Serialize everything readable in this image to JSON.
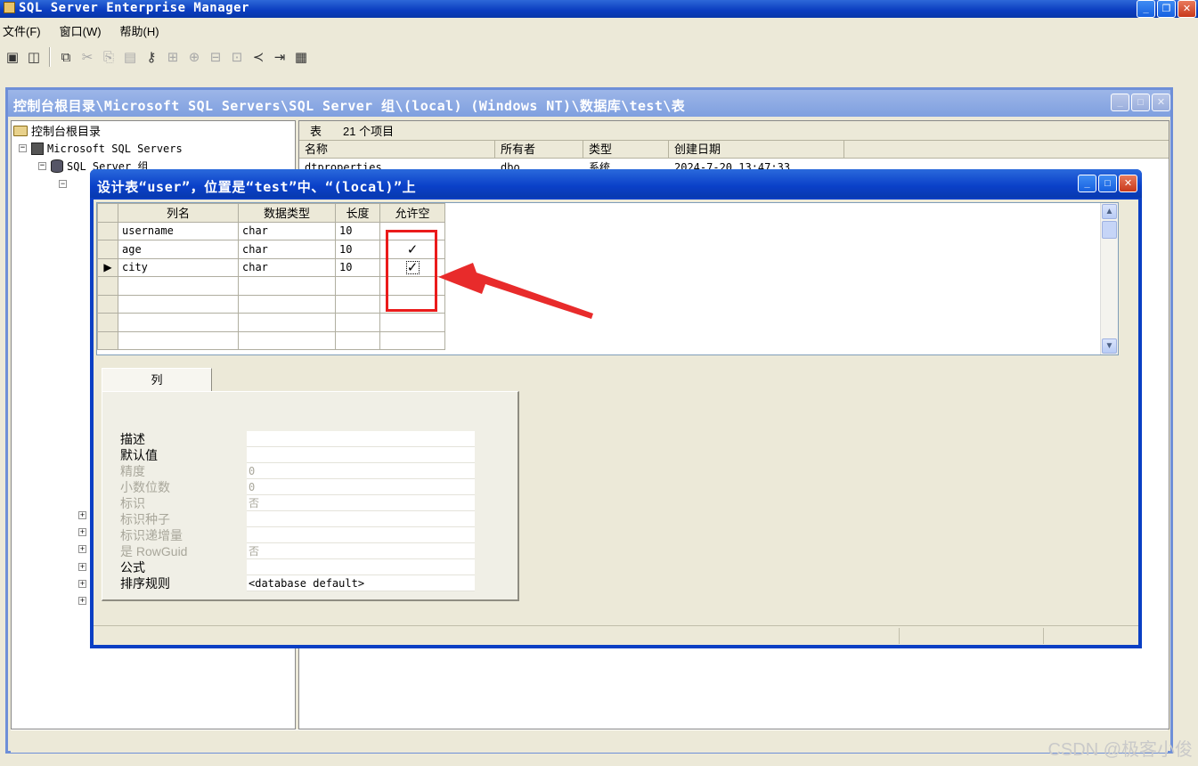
{
  "app": {
    "title": "SQL Server Enterprise Manager",
    "menu": [
      "文件(F)",
      "窗口(W)",
      "帮助(H)"
    ]
  },
  "toolbar": {
    "icons": [
      "save-icon",
      "properties-icon",
      "new-window-icon",
      "cut-icon",
      "copy-icon",
      "paste-icon",
      "key-icon",
      "relationships-icon",
      "indexes-icon",
      "constraints-icon",
      "triggers-icon",
      "generate-script-icon",
      "insert-column-icon",
      "grid-icon"
    ]
  },
  "mdi": {
    "title": "控制台根目录\\Microsoft SQL Servers\\SQL Server 组\\(local) (Windows NT)\\数据库\\test\\表",
    "tree": {
      "root": "控制台根目录",
      "servers": "Microsoft SQL Servers",
      "group": "SQL Server 组"
    },
    "list_header": {
      "label": "表",
      "count": "21 个项目"
    },
    "columns": [
      "名称",
      "所有者",
      "类型",
      "创建日期"
    ],
    "first_row": {
      "name": "dtproperties",
      "owner": "dbo",
      "type": "系统",
      "created": "2024-7-20 13:47:33"
    }
  },
  "dialog": {
    "title": "设计表“user”，位置是“test”中、“(local)”上",
    "grid": {
      "headers": [
        "列名",
        "数据类型",
        "长度",
        "允许空"
      ],
      "rows": [
        {
          "name": "username",
          "type": "char",
          "length": "10",
          "nullable": ""
        },
        {
          "name": "age",
          "type": "char",
          "length": "10",
          "nullable": "✓"
        },
        {
          "name": "city",
          "type": "char",
          "length": "10",
          "nullable": "✓"
        }
      ],
      "current_marker": "▶"
    },
    "tab_label": "列",
    "properties": [
      {
        "label": "描述",
        "value": "",
        "disabled": false
      },
      {
        "label": "默认值",
        "value": "",
        "disabled": false
      },
      {
        "label": "精度",
        "value": "0",
        "disabled": true
      },
      {
        "label": "小数位数",
        "value": "0",
        "disabled": true
      },
      {
        "label": "标识",
        "value": "否",
        "disabled": true
      },
      {
        "label": "标识种子",
        "value": "",
        "disabled": true
      },
      {
        "label": "标识递增量",
        "value": "",
        "disabled": true
      },
      {
        "label": "是 RowGuid",
        "value": "否",
        "disabled": true
      },
      {
        "label": "公式",
        "value": "",
        "disabled": false
      },
      {
        "label": "排序规则",
        "value": "<database default>",
        "disabled": false
      }
    ]
  },
  "watermark": "CSDN @极客小俊",
  "colors": {
    "highlight": "#ea1b1b",
    "xp_blue": "#0a40c8"
  }
}
